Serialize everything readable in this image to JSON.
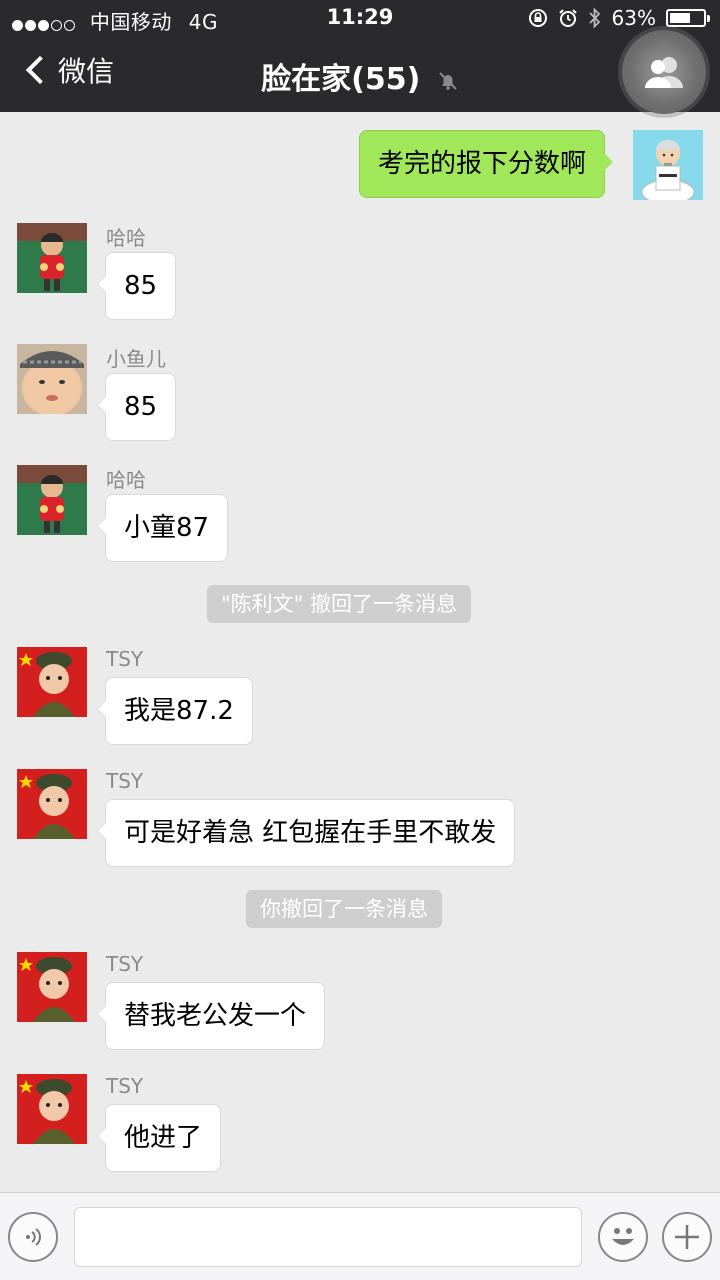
{
  "status_bar": {
    "carrier": "中国移动",
    "network": "4G",
    "signal_full": 3,
    "signal_total": 5,
    "time": "11:29",
    "battery_percent": "63%",
    "battery_level": 0.63
  },
  "nav": {
    "back_label": "微信",
    "title": "脸在家(55)",
    "muted": true
  },
  "messages": [
    {
      "side": "right",
      "text": "考完的报下分数啊",
      "avatar": "self-avatar"
    },
    {
      "side": "left",
      "sender": "哈哈",
      "text": "85",
      "avatar": "child-red-shirt"
    },
    {
      "side": "left",
      "sender": "小鱼儿",
      "text": "85",
      "avatar": "baby-cap"
    },
    {
      "side": "left",
      "sender": "哈哈",
      "text": "小童87",
      "avatar": "child-red-shirt"
    },
    {
      "type": "notice",
      "text": "\"陈利文\" 撤回了一条消息"
    },
    {
      "side": "left",
      "sender": "TSY",
      "text": "我是87.2",
      "avatar": "baby-red-flag"
    },
    {
      "side": "left",
      "sender": "TSY",
      "text": "可是好着急 红包握在手里不敢发",
      "avatar": "baby-red-flag"
    },
    {
      "type": "notice",
      "text": "你撤回了一条消息"
    },
    {
      "side": "left",
      "sender": "TSY",
      "text": "替我老公发一个",
      "avatar": "baby-red-flag"
    },
    {
      "side": "left",
      "sender": "TSY",
      "text": "他进了",
      "avatar": "baby-red-flag"
    }
  ],
  "input_bar": {
    "voice_icon": "voice-icon",
    "emoji_icon": "emoji-icon",
    "plus_icon": "plus-icon",
    "text_value": ""
  },
  "colors": {
    "header_bg": "#2a2a2d",
    "chat_bg": "#ebebeb",
    "self_bubble": "#a0e75a",
    "other_bubble": "#ffffff",
    "notice_bg": "#cecece"
  }
}
